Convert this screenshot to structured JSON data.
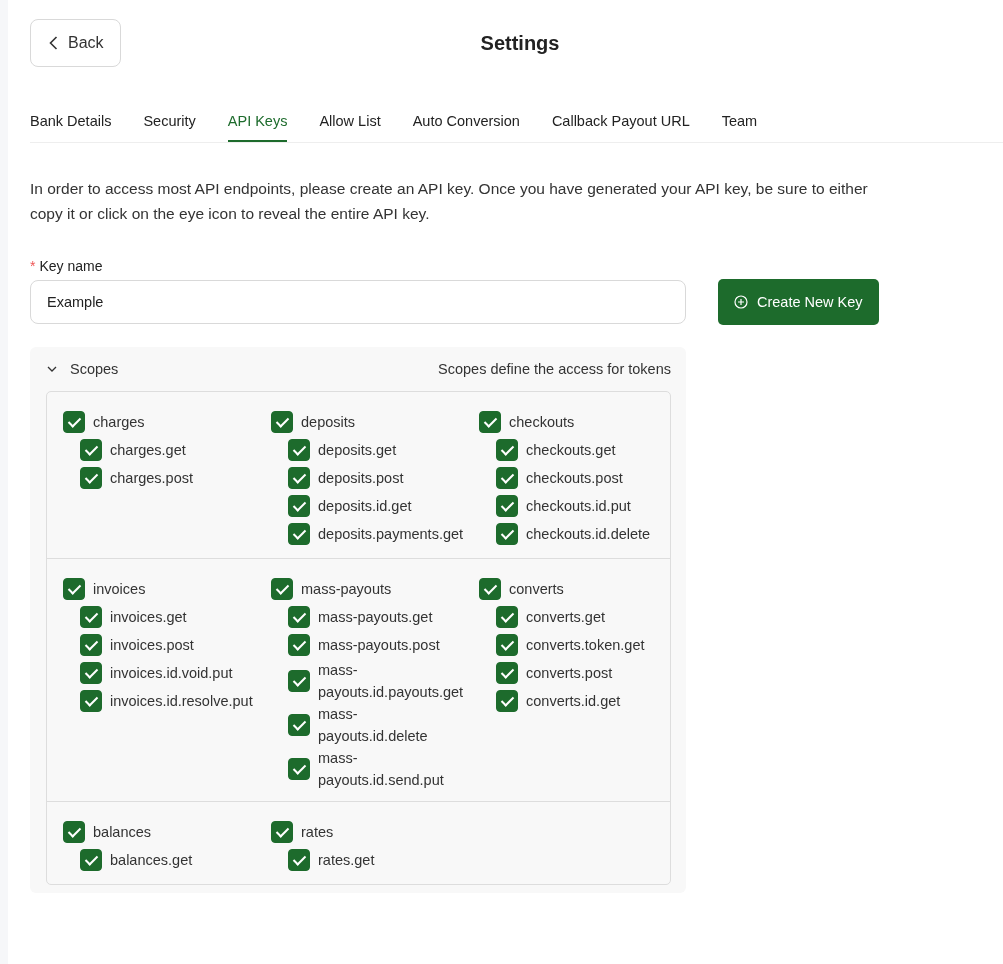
{
  "header": {
    "back_label": "Back",
    "title": "Settings"
  },
  "tabs": [
    {
      "label": "Bank Details",
      "selected": false
    },
    {
      "label": "Security",
      "selected": false
    },
    {
      "label": "API Keys",
      "selected": true
    },
    {
      "label": "Allow List",
      "selected": false
    },
    {
      "label": "Auto Conversion",
      "selected": false
    },
    {
      "label": "Callback Payout URL",
      "selected": false
    },
    {
      "label": "Team",
      "selected": false
    }
  ],
  "description": "In order to access most API endpoints, please create an API key. Once you have generated your API key, be sure to either copy it or click on the eye icon to reveal the entire API key.",
  "key_field": {
    "required_mark": "*",
    "label": "Key name",
    "value": "Example"
  },
  "create_button": "Create New Key",
  "scopes": {
    "title": "Scopes",
    "expanded": true,
    "hint": "Scopes define the access for tokens",
    "sections": [
      {
        "groups": [
          {
            "label": "charges",
            "checked": true,
            "children": [
              {
                "label": "charges.get",
                "checked": true
              },
              {
                "label": "charges.post",
                "checked": true
              }
            ]
          },
          {
            "label": "deposits",
            "checked": true,
            "children": [
              {
                "label": "deposits.get",
                "checked": true
              },
              {
                "label": "deposits.post",
                "checked": true
              },
              {
                "label": "deposits.id.get",
                "checked": true
              },
              {
                "label": "deposits.payments.get",
                "checked": true
              }
            ]
          },
          {
            "label": "checkouts",
            "checked": true,
            "children": [
              {
                "label": "checkouts.get",
                "checked": true
              },
              {
                "label": "checkouts.post",
                "checked": true
              },
              {
                "label": "checkouts.id.put",
                "checked": true
              },
              {
                "label": "checkouts.id.delete",
                "checked": true
              }
            ]
          }
        ]
      },
      {
        "groups": [
          {
            "label": "invoices",
            "checked": true,
            "children": [
              {
                "label": "invoices.get",
                "checked": true
              },
              {
                "label": "invoices.post",
                "checked": true
              },
              {
                "label": "invoices.id.void.put",
                "checked": true
              },
              {
                "label": "invoices.id.resolve.put",
                "checked": true
              }
            ]
          },
          {
            "label": "mass-payouts",
            "checked": true,
            "children": [
              {
                "label": "mass-payouts.get",
                "checked": true
              },
              {
                "label": "mass-payouts.post",
                "checked": true
              },
              {
                "label": "mass-payouts.id.payouts.get",
                "checked": true
              },
              {
                "label": "mass-payouts.id.delete",
                "checked": true
              },
              {
                "label": "mass-payouts.id.send.put",
                "checked": true
              }
            ]
          },
          {
            "label": "converts",
            "checked": true,
            "children": [
              {
                "label": "converts.get",
                "checked": true
              },
              {
                "label": "converts.token.get",
                "checked": true
              },
              {
                "label": "converts.post",
                "checked": true
              },
              {
                "label": "converts.id.get",
                "checked": true
              }
            ]
          }
        ]
      },
      {
        "groups": [
          {
            "label": "balances",
            "checked": true,
            "children": [
              {
                "label": "balances.get",
                "checked": true
              }
            ]
          },
          {
            "label": "rates",
            "checked": true,
            "children": [
              {
                "label": "rates.get",
                "checked": true
              }
            ]
          }
        ]
      }
    ]
  }
}
